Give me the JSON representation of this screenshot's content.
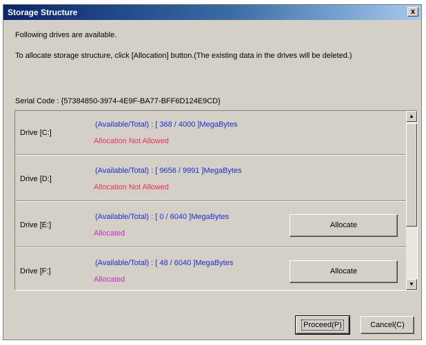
{
  "window": {
    "title": "Storage Structure",
    "close_label": "x"
  },
  "intro": {
    "line1": "Following drives are available.",
    "line2": "To allocate storage structure, click [Allocation] button.(The existing data in the drives will be deleted.)"
  },
  "serial": {
    "text": "Serial Code : {57384850-3974-4E9F-BA77-BFF6D124E9CD}"
  },
  "drives": [
    {
      "label": "Drive [C:]",
      "capacity": "(Available/Total) : [ 368 / 4000 ]MegaBytes",
      "status": "Allocation Not Allowed"
    },
    {
      "label": "Drive [D:]",
      "capacity": "(Available/Total) : [ 9656 / 9991 ]MegaBytes",
      "status": "Allocation Not Allowed"
    },
    {
      "label": "Drive [E:]",
      "capacity": "(Available/Total) : [ 0 / 6040 ]MegaBytes",
      "status": "Allocated",
      "button": "Allocate"
    },
    {
      "label": "Drive [F:]",
      "capacity": "(Available/Total) : [ 48 / 6040 ]MegaBytes",
      "status": "Allocated",
      "button": "Allocate"
    }
  ],
  "scrollbar": {
    "up": "▲",
    "down": "▼"
  },
  "buttons": {
    "proceed": "Proceed(P)",
    "cancel": "Cancel(C)"
  },
  "colors": {
    "capacity": "#1f2ccc",
    "not_allowed": "#e8325a",
    "allocated": "#c828c8"
  }
}
